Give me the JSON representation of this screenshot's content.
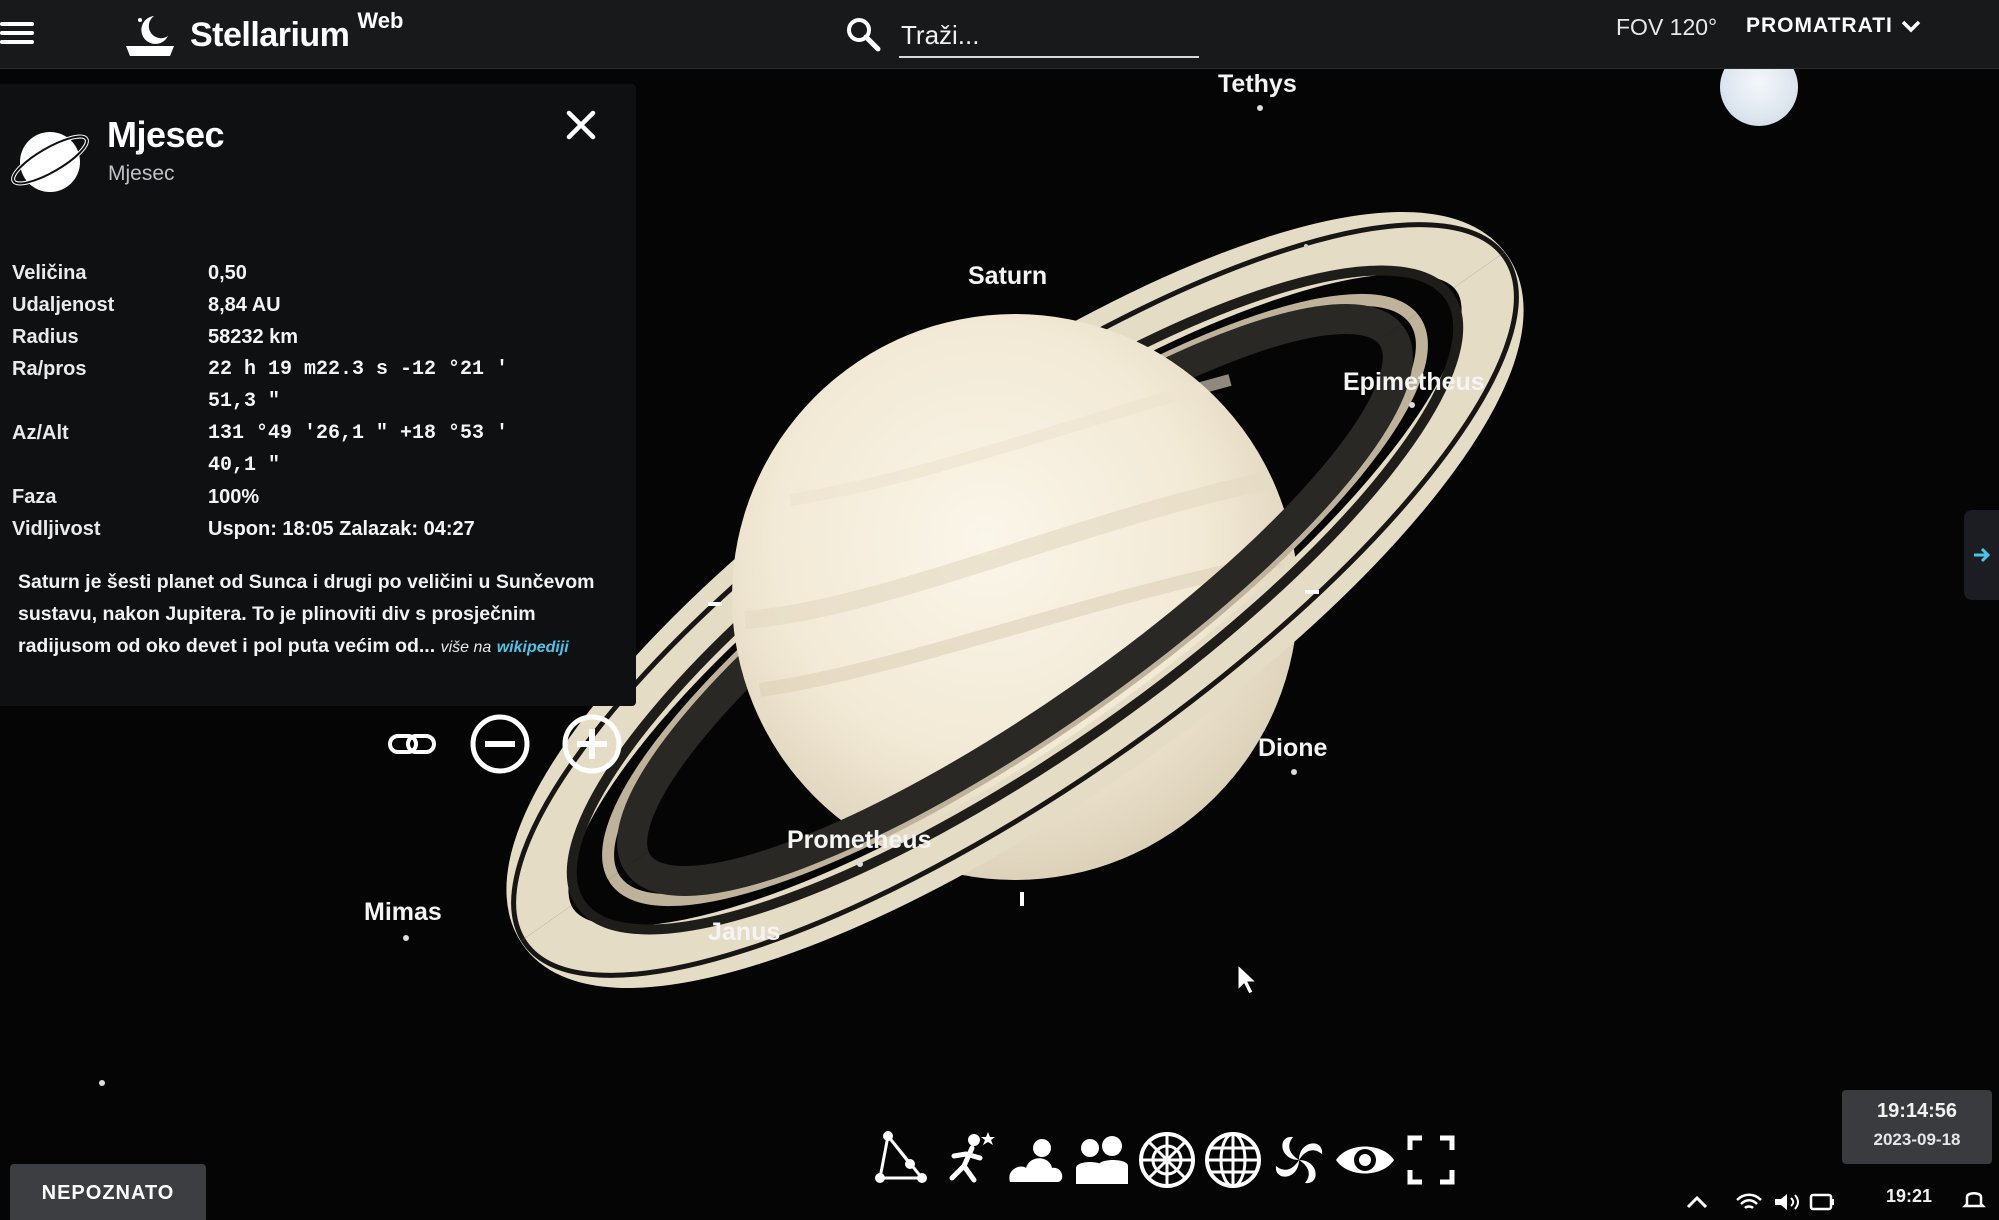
{
  "app": {
    "name": "Stellarium",
    "name_suffix": "Web",
    "fov": "FOV 120°",
    "mode_label": "PROMATRATI",
    "accent": "#49c5e8"
  },
  "search": {
    "placeholder": "Traži..."
  },
  "info_panel": {
    "title": "Mjesec",
    "subtitle": "Mjesec",
    "properties": [
      {
        "label": "Veličina",
        "value": "0,50"
      },
      {
        "label": "Udaljenost",
        "value": "8,84 AU"
      },
      {
        "label": "Radius",
        "value": "58232 km"
      },
      {
        "label": "Ra/pros",
        "value": "22 h 19 m22.3 s -12 °21 '",
        "value2": "51,3 \""
      },
      {
        "label": "Az/Alt",
        "value": "131 °49 '26,1 \" +18 °53 '",
        "value2": "40,1 \""
      },
      {
        "label": "Faza",
        "value": "100%"
      },
      {
        "label": "Vidljivost",
        "value": "Uspon: 18:05 Zalazak: 04:27"
      }
    ],
    "description": "Saturn je šesti planet od Sunca i drugi po veličini u Sunčevom sustavu, nakon Jupitera. To je plinoviti div s prosječnim radijusom od oko devet i pol puta većim od...",
    "more_prefix": "više na",
    "more_link": "wikipediji"
  },
  "sky_labels": {
    "tethys": "Tethys",
    "saturn": "Saturn",
    "epimetheus": "Epimetheus",
    "dione": "Dione",
    "prometheus": "Prometheus",
    "mimas": "Mimas",
    "janus": "Janus"
  },
  "clock": {
    "time": "19:14:56",
    "date": "2023-09-18"
  },
  "location": "NEPOZNATO",
  "taskbar": {
    "time": "19:21"
  }
}
